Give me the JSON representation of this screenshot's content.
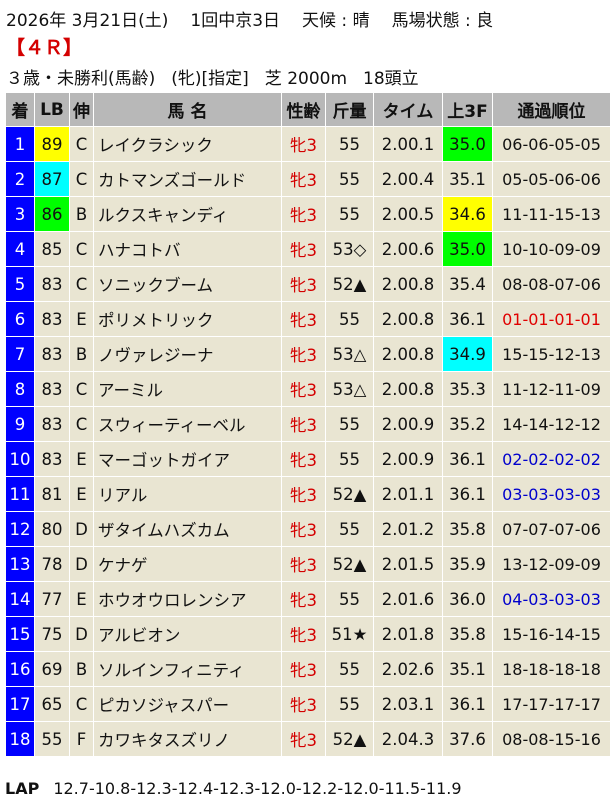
{
  "header": {
    "date": "2026年 3月21日(土)",
    "meeting": "1回中京3日",
    "weather": "天候 : 晴",
    "track_condition": "馬場状態 : 良",
    "race": "【４Ｒ】",
    "class": "３歳・未勝利(馬齢)",
    "conditions": "(牝)[指定]",
    "distance": "芝 2000m",
    "runners": "18頭立"
  },
  "columns": [
    "着",
    "LB",
    "伸",
    "馬 名",
    "性齢",
    "斤量",
    "タイム",
    "上3F",
    "通過順位"
  ],
  "colors": {
    "number_bg": "#0000ff",
    "row_bg": "#e9e5d2",
    "header_bg": "#b8b8b8",
    "lb_highlight_1": "#ffff00",
    "lb_highlight_2": "#00ffff",
    "lb_highlight_3": "#00ff00",
    "f3_green": "#00ff00",
    "f3_yellow": "#ffff00",
    "f3_cyan": "#00ffff",
    "sex_red": "#d40000",
    "pos_red": "#e00000",
    "pos_blue": "#0000cc"
  },
  "rows": [
    {
      "rank": "1",
      "lb": "89",
      "lb_color": "#ffff00",
      "nobi": "C",
      "name": "レイクラシック",
      "sex": "牝3",
      "weight": "55",
      "time": "2.00.1",
      "f3": "35.0",
      "f3_color": "#00ff00",
      "pos": "06-06-05-05",
      "pos_color": ""
    },
    {
      "rank": "2",
      "lb": "87",
      "lb_color": "#00ffff",
      "nobi": "C",
      "name": "カトマンズゴールド",
      "sex": "牝3",
      "weight": "55",
      "time": "2.00.4",
      "f3": "35.1",
      "f3_color": "",
      "pos": "05-05-06-06",
      "pos_color": ""
    },
    {
      "rank": "3",
      "lb": "86",
      "lb_color": "#00ff00",
      "nobi": "B",
      "name": "ルクスキャンディ",
      "sex": "牝3",
      "weight": "55",
      "time": "2.00.5",
      "f3": "34.6",
      "f3_color": "#ffff00",
      "pos": "11-11-15-13",
      "pos_color": ""
    },
    {
      "rank": "4",
      "lb": "85",
      "lb_color": "",
      "nobi": "C",
      "name": "ハナコトバ",
      "sex": "牝3",
      "weight": "53◇",
      "time": "2.00.6",
      "f3": "35.0",
      "f3_color": "#00ff00",
      "pos": "10-10-09-09",
      "pos_color": ""
    },
    {
      "rank": "5",
      "lb": "83",
      "lb_color": "",
      "nobi": "C",
      "name": "ソニックブーム",
      "sex": "牝3",
      "weight": "52▲",
      "time": "2.00.8",
      "f3": "35.4",
      "f3_color": "",
      "pos": "08-08-07-06",
      "pos_color": ""
    },
    {
      "rank": "6",
      "lb": "83",
      "lb_color": "",
      "nobi": "E",
      "name": "ポリメトリック",
      "sex": "牝3",
      "weight": "55",
      "time": "2.00.8",
      "f3": "36.1",
      "f3_color": "",
      "pos": "01-01-01-01",
      "pos_color": "#e00000"
    },
    {
      "rank": "7",
      "lb": "83",
      "lb_color": "",
      "nobi": "B",
      "name": "ノヴァレジーナ",
      "sex": "牝3",
      "weight": "53△",
      "time": "2.00.8",
      "f3": "34.9",
      "f3_color": "#00ffff",
      "pos": "15-15-12-13",
      "pos_color": ""
    },
    {
      "rank": "8",
      "lb": "83",
      "lb_color": "",
      "nobi": "C",
      "name": "アーミル",
      "sex": "牝3",
      "weight": "53△",
      "time": "2.00.8",
      "f3": "35.3",
      "f3_color": "",
      "pos": "11-12-11-09",
      "pos_color": ""
    },
    {
      "rank": "9",
      "lb": "83",
      "lb_color": "",
      "nobi": "C",
      "name": "スウィーティーベル",
      "sex": "牝3",
      "weight": "55",
      "time": "2.00.9",
      "f3": "35.2",
      "f3_color": "",
      "pos": "14-14-12-12",
      "pos_color": ""
    },
    {
      "rank": "10",
      "lb": "83",
      "lb_color": "",
      "nobi": "E",
      "name": "マーゴットガイア",
      "sex": "牝3",
      "weight": "55",
      "time": "2.00.9",
      "f3": "36.1",
      "f3_color": "",
      "pos": "02-02-02-02",
      "pos_color": "#0000cc"
    },
    {
      "rank": "11",
      "lb": "81",
      "lb_color": "",
      "nobi": "E",
      "name": "リアル",
      "sex": "牝3",
      "weight": "52▲",
      "time": "2.01.1",
      "f3": "36.1",
      "f3_color": "",
      "pos": "03-03-03-03",
      "pos_color": "#0000cc"
    },
    {
      "rank": "12",
      "lb": "80",
      "lb_color": "",
      "nobi": "D",
      "name": "ザタイムハズカム",
      "sex": "牝3",
      "weight": "55",
      "time": "2.01.2",
      "f3": "35.8",
      "f3_color": "",
      "pos": "07-07-07-06",
      "pos_color": ""
    },
    {
      "rank": "13",
      "lb": "78",
      "lb_color": "",
      "nobi": "D",
      "name": "ケナゲ",
      "sex": "牝3",
      "weight": "52▲",
      "time": "2.01.5",
      "f3": "35.9",
      "f3_color": "",
      "pos": "13-12-09-09",
      "pos_color": ""
    },
    {
      "rank": "14",
      "lb": "77",
      "lb_color": "",
      "nobi": "E",
      "name": "ホウオウロレンシア",
      "sex": "牝3",
      "weight": "55",
      "time": "2.01.6",
      "f3": "36.0",
      "f3_color": "",
      "pos": "04-03-03-03",
      "pos_color": "#0000cc"
    },
    {
      "rank": "15",
      "lb": "75",
      "lb_color": "",
      "nobi": "D",
      "name": "アルビオン",
      "sex": "牝3",
      "weight": "51★",
      "time": "2.01.8",
      "f3": "35.8",
      "f3_color": "",
      "pos": "15-16-14-15",
      "pos_color": ""
    },
    {
      "rank": "16",
      "lb": "69",
      "lb_color": "",
      "nobi": "B",
      "name": "ソルインフィニティ",
      "sex": "牝3",
      "weight": "55",
      "time": "2.02.6",
      "f3": "35.1",
      "f3_color": "",
      "pos": "18-18-18-18",
      "pos_color": ""
    },
    {
      "rank": "17",
      "lb": "65",
      "lb_color": "",
      "nobi": "C",
      "name": "ピカソジャスパー",
      "sex": "牝3",
      "weight": "55",
      "time": "2.03.1",
      "f3": "36.1",
      "f3_color": "",
      "pos": "17-17-17-17",
      "pos_color": ""
    },
    {
      "rank": "18",
      "lb": "55",
      "lb_color": "",
      "nobi": "F",
      "name": "カワキタスズリノ",
      "sex": "牝3",
      "weight": "52▲",
      "time": "2.04.3",
      "f3": "37.6",
      "f3_color": "",
      "pos": "08-08-15-16",
      "pos_color": ""
    }
  ],
  "footer": {
    "lap_label": "LAP",
    "laps": "12.7-10.8-12.3-12.4-12.3-12.0-12.2-12.0-11.5-11.9"
  }
}
